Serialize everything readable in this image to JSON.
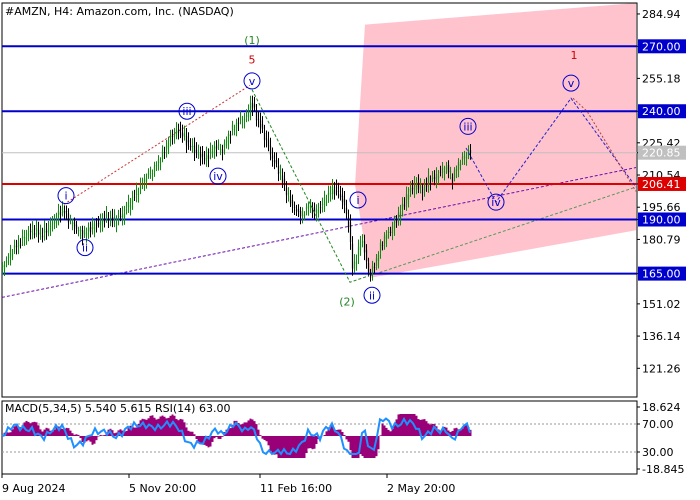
{
  "chart_data": {
    "type": "line",
    "title": "#AMZN, H4:  Amazon.com, Inc. (NASDAQ)",
    "y_ticks": [
      "284.94",
      "270.00",
      "255.18",
      "240.00",
      "225.42",
      "220.85",
      "210.54",
      "206.41",
      "195.66",
      "190.00",
      "180.79",
      "165.00",
      "151.02",
      "136.14",
      "121.26"
    ],
    "ylim": [
      108,
      290
    ],
    "x_ticks": [
      "9 Aug 2024",
      "5 Nov 20:00",
      "11 Feb 16:00",
      "2 May 20:00"
    ],
    "current_price": {
      "value": 220.85,
      "label": "220.85"
    },
    "levels": [
      {
        "value": 270.0,
        "label": "270.00",
        "color": "#0000cc"
      },
      {
        "value": 240.0,
        "label": "240.00",
        "color": "#0000cc"
      },
      {
        "value": 206.41,
        "label": "206.41",
        "color": "#dd0000"
      },
      {
        "value": 190.0,
        "label": "190.00",
        "color": "#0000cc"
      },
      {
        "value": 165.0,
        "label": "165.00",
        "color": "#0000cc"
      }
    ],
    "price_path": [
      [
        0,
        168
      ],
      [
        10,
        176
      ],
      [
        20,
        181
      ],
      [
        30,
        185
      ],
      [
        40,
        183
      ],
      [
        50,
        188
      ],
      [
        60,
        195
      ],
      [
        65,
        191
      ],
      [
        72,
        187
      ],
      [
        80,
        183
      ],
      [
        88,
        186
      ],
      [
        96,
        188
      ],
      [
        104,
        191
      ],
      [
        112,
        189
      ],
      [
        120,
        192
      ],
      [
        128,
        198
      ],
      [
        136,
        204
      ],
      [
        144,
        210
      ],
      [
        152,
        214
      ],
      [
        160,
        220
      ],
      [
        166,
        226
      ],
      [
        172,
        230
      ],
      [
        178,
        231
      ],
      [
        184,
        226
      ],
      [
        190,
        223
      ],
      [
        196,
        220
      ],
      [
        202,
        218
      ],
      [
        208,
        221
      ],
      [
        214,
        224
      ],
      [
        220,
        222
      ],
      [
        226,
        229
      ],
      [
        232,
        233
      ],
      [
        238,
        236
      ],
      [
        244,
        237
      ],
      [
        248,
        244
      ],
      [
        252,
        240
      ],
      [
        258,
        233
      ],
      [
        264,
        226
      ],
      [
        270,
        218
      ],
      [
        276,
        213
      ],
      [
        282,
        205
      ],
      [
        288,
        198
      ],
      [
        294,
        194
      ],
      [
        300,
        192
      ],
      [
        306,
        197
      ],
      [
        312,
        193
      ],
      [
        318,
        196
      ],
      [
        324,
        200
      ],
      [
        330,
        204
      ],
      [
        336,
        203
      ],
      [
        342,
        196
      ],
      [
        346,
        188
      ],
      [
        350,
        168
      ],
      [
        355,
        173
      ],
      [
        359,
        183
      ],
      [
        363,
        172
      ],
      [
        367,
        164
      ],
      [
        371,
        168
      ],
      [
        375,
        173
      ],
      [
        379,
        179
      ],
      [
        384,
        183
      ],
      [
        390,
        186
      ],
      [
        396,
        192
      ],
      [
        402,
        198
      ],
      [
        408,
        204
      ],
      [
        414,
        206
      ],
      [
        420,
        203
      ],
      [
        426,
        208
      ],
      [
        432,
        209
      ],
      [
        438,
        212
      ],
      [
        444,
        214
      ],
      [
        450,
        209
      ],
      [
        456,
        216
      ],
      [
        462,
        219
      ],
      [
        466,
        221
      ],
      [
        469,
        220.85
      ]
    ],
    "wave_labels": [
      {
        "text": "i",
        "x": 64,
        "y": 201,
        "style": "circle",
        "color": "#0000cc"
      },
      {
        "text": "ii",
        "x": 83,
        "y": 177,
        "style": "circle",
        "color": "#0000cc"
      },
      {
        "text": "iii",
        "x": 185,
        "y": 240,
        "style": "circle",
        "color": "#0000cc"
      },
      {
        "text": "iv",
        "x": 216,
        "y": 210,
        "style": "circle",
        "color": "#0000cc"
      },
      {
        "text": "v",
        "x": 250,
        "y": 254,
        "style": "circle",
        "color": "#0000cc"
      },
      {
        "text": "5",
        "x": 250,
        "y": 264,
        "style": "plain",
        "color": "#cc0000"
      },
      {
        "text": "(1)",
        "x": 250,
        "y": 273,
        "style": "plain",
        "color": "#228822"
      },
      {
        "text": "i",
        "x": 356,
        "y": 199,
        "style": "circle",
        "color": "#0000cc"
      },
      {
        "text": "(2)",
        "x": 345,
        "y": 152,
        "style": "plain",
        "color": "#228822"
      },
      {
        "text": "ii",
        "x": 370,
        "y": 155,
        "style": "circle",
        "color": "#0000cc"
      },
      {
        "text": "iii",
        "x": 466,
        "y": 233,
        "style": "circle",
        "color": "#0000cc"
      },
      {
        "text": "iv",
        "x": 494,
        "y": 198,
        "style": "circle",
        "color": "#0000cc"
      },
      {
        "text": "v",
        "x": 569,
        "y": 253,
        "style": "circle",
        "color": "#0000cc"
      },
      {
        "text": "1",
        "x": 572,
        "y": 266,
        "style": "plain",
        "color": "#cc0000"
      }
    ],
    "forecast_path": [
      [
        464,
        223
      ],
      [
        494,
        198
      ],
      [
        569,
        246
      ],
      [
        634,
        205
      ]
    ],
    "indicator": {
      "label": "MACD(5,34,5) 5.540 5.615 RSI(14) 63.00",
      "y_ticks": [
        "18.624",
        "70.00",
        "30.00",
        "-18.845"
      ]
    }
  }
}
